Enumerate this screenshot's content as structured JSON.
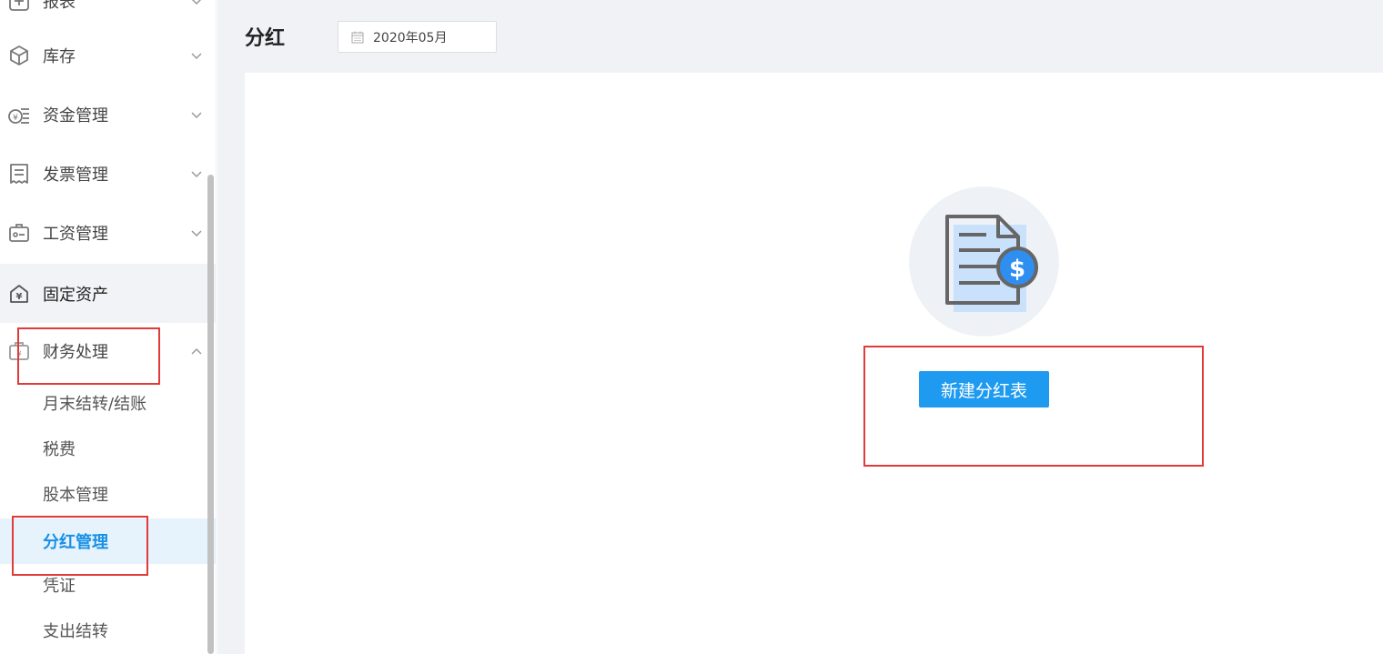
{
  "sidebar": {
    "items": [
      {
        "label": "报表",
        "icon": "report-icon",
        "expandable": true
      },
      {
        "label": "库存",
        "icon": "box-icon",
        "expandable": true
      },
      {
        "label": "资金管理",
        "icon": "money-icon",
        "expandable": true
      },
      {
        "label": "发票管理",
        "icon": "invoice-icon",
        "expandable": true
      },
      {
        "label": "工资管理",
        "icon": "salary-icon",
        "expandable": true
      },
      {
        "label": "固定资产",
        "icon": "house-yen-icon",
        "expandable": false
      },
      {
        "label": "财务处理",
        "icon": "finance-icon",
        "expandable": true,
        "expanded": true
      }
    ],
    "subitems": [
      {
        "label": "月末结转/结账"
      },
      {
        "label": "税费"
      },
      {
        "label": "股本管理"
      },
      {
        "label": "分红管理",
        "selected": true
      },
      {
        "label": "凭证"
      },
      {
        "label": "支出结转"
      }
    ]
  },
  "header": {
    "title": "分红",
    "date_value": "2020年05月"
  },
  "main": {
    "create_button_label": "新建分红表"
  },
  "colors": {
    "accent": "#1e9bf0",
    "highlight": "#e03a3a",
    "selected_bg": "#e6f3fd",
    "header_bg": "#f0f2f5"
  }
}
